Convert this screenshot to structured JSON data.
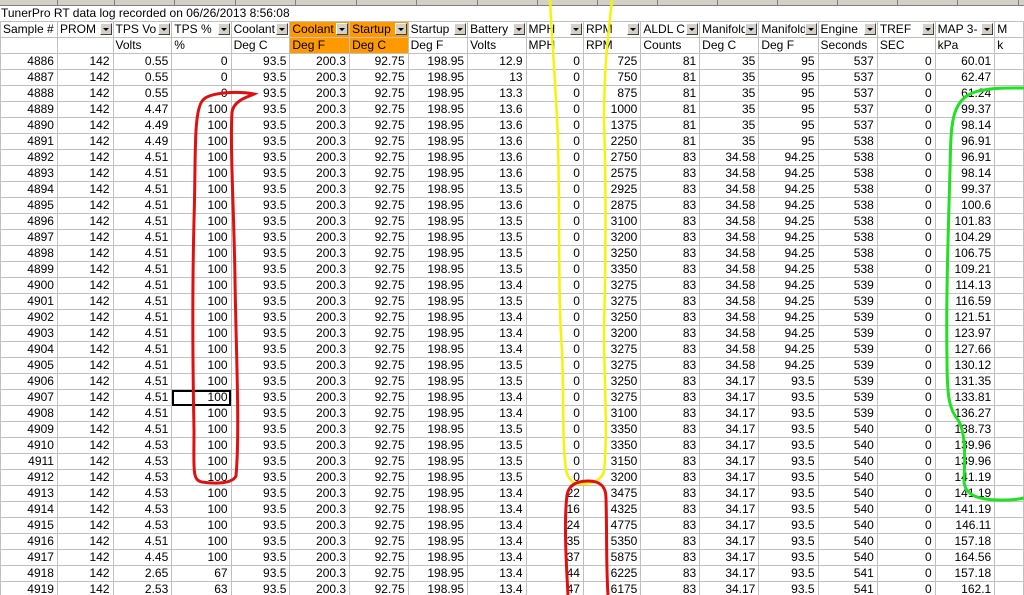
{
  "title": "TunerPro RT data log recorded on 06/26/2013 8:56:08",
  "columns": [
    {
      "header": "Sample #",
      "unit": "",
      "filter": false,
      "highlight": false
    },
    {
      "header": "PROM",
      "unit": "",
      "filter": true,
      "highlight": false
    },
    {
      "header": "TPS Vo",
      "unit": "Volts",
      "filter": true,
      "highlight": false
    },
    {
      "header": "TPS %",
      "unit": "%",
      "filter": true,
      "highlight": false
    },
    {
      "header": "Coolant",
      "unit": "Deg C",
      "filter": true,
      "highlight": false
    },
    {
      "header": "Coolant",
      "unit": "Deg F",
      "filter": true,
      "highlight": true
    },
    {
      "header": "Startup",
      "unit": "Deg C",
      "filter": true,
      "highlight": true
    },
    {
      "header": "Startup",
      "unit": "Deg F",
      "filter": true,
      "highlight": false
    },
    {
      "header": "Battery",
      "unit": "Volts",
      "filter": true,
      "highlight": false
    },
    {
      "header": "MPH",
      "unit": "MPH",
      "filter": true,
      "highlight": false
    },
    {
      "header": "RPM",
      "unit": "RPM",
      "filter": true,
      "highlight": false
    },
    {
      "header": "ALDL C",
      "unit": "Counts",
      "filter": true,
      "highlight": false
    },
    {
      "header": "Manifold",
      "unit": "Deg C",
      "filter": true,
      "highlight": false
    },
    {
      "header": "Manifold",
      "unit": "Deg F",
      "filter": true,
      "highlight": false
    },
    {
      "header": "Engine",
      "unit": "Seconds",
      "filter": true,
      "highlight": false
    },
    {
      "header": "TREF",
      "unit": "SEC",
      "filter": true,
      "highlight": false
    },
    {
      "header": "MAP 3-",
      "unit": "kPa",
      "filter": true,
      "highlight": false
    },
    {
      "header": "M",
      "unit": "k",
      "filter": false,
      "highlight": false
    }
  ],
  "rows": [
    [
      "4886",
      "142",
      "0.55",
      "0",
      "93.5",
      "200.3",
      "92.75",
      "198.95",
      "12.9",
      "0",
      "725",
      "81",
      "35",
      "95",
      "537",
      "0",
      "60.01",
      ""
    ],
    [
      "4887",
      "142",
      "0.55",
      "0",
      "93.5",
      "200.3",
      "92.75",
      "198.95",
      "13",
      "0",
      "750",
      "81",
      "35",
      "95",
      "537",
      "0",
      "62.47",
      ""
    ],
    [
      "4888",
      "142",
      "0.55",
      "0",
      "93.5",
      "200.3",
      "92.75",
      "198.95",
      "13.3",
      "0",
      "875",
      "81",
      "35",
      "95",
      "537",
      "0",
      "61.24",
      ""
    ],
    [
      "4889",
      "142",
      "4.47",
      "100",
      "93.5",
      "200.3",
      "92.75",
      "198.95",
      "13.6",
      "0",
      "1000",
      "81",
      "35",
      "95",
      "537",
      "0",
      "99.37",
      ""
    ],
    [
      "4890",
      "142",
      "4.49",
      "100",
      "93.5",
      "200.3",
      "92.75",
      "198.95",
      "13.6",
      "0",
      "1375",
      "81",
      "35",
      "95",
      "537",
      "0",
      "98.14",
      ""
    ],
    [
      "4891",
      "142",
      "4.49",
      "100",
      "93.5",
      "200.3",
      "92.75",
      "198.95",
      "13.6",
      "0",
      "2250",
      "81",
      "35",
      "95",
      "538",
      "0",
      "96.91",
      ""
    ],
    [
      "4892",
      "142",
      "4.51",
      "100",
      "93.5",
      "200.3",
      "92.75",
      "198.95",
      "13.6",
      "0",
      "2750",
      "83",
      "34.58",
      "94.25",
      "538",
      "0",
      "96.91",
      ""
    ],
    [
      "4893",
      "142",
      "4.51",
      "100",
      "93.5",
      "200.3",
      "92.75",
      "198.95",
      "13.6",
      "0",
      "2575",
      "83",
      "34.58",
      "94.25",
      "538",
      "0",
      "98.14",
      ""
    ],
    [
      "4894",
      "142",
      "4.51",
      "100",
      "93.5",
      "200.3",
      "92.75",
      "198.95",
      "13.5",
      "0",
      "2925",
      "83",
      "34.58",
      "94.25",
      "538",
      "0",
      "99.37",
      ""
    ],
    [
      "4895",
      "142",
      "4.51",
      "100",
      "93.5",
      "200.3",
      "92.75",
      "198.95",
      "13.6",
      "0",
      "2875",
      "83",
      "34.58",
      "94.25",
      "538",
      "0",
      "100.6",
      ""
    ],
    [
      "4896",
      "142",
      "4.51",
      "100",
      "93.5",
      "200.3",
      "92.75",
      "198.95",
      "13.5",
      "0",
      "3100",
      "83",
      "34.58",
      "94.25",
      "538",
      "0",
      "101.83",
      ""
    ],
    [
      "4897",
      "142",
      "4.51",
      "100",
      "93.5",
      "200.3",
      "92.75",
      "198.95",
      "13.5",
      "0",
      "3200",
      "83",
      "34.58",
      "94.25",
      "538",
      "0",
      "104.29",
      ""
    ],
    [
      "4898",
      "142",
      "4.51",
      "100",
      "93.5",
      "200.3",
      "92.75",
      "198.95",
      "13.5",
      "0",
      "3250",
      "83",
      "34.58",
      "94.25",
      "538",
      "0",
      "106.75",
      ""
    ],
    [
      "4899",
      "142",
      "4.51",
      "100",
      "93.5",
      "200.3",
      "92.75",
      "198.95",
      "13.5",
      "0",
      "3350",
      "83",
      "34.58",
      "94.25",
      "538",
      "0",
      "109.21",
      ""
    ],
    [
      "4900",
      "142",
      "4.51",
      "100",
      "93.5",
      "200.3",
      "92.75",
      "198.95",
      "13.4",
      "0",
      "3275",
      "83",
      "34.58",
      "94.25",
      "539",
      "0",
      "114.13",
      ""
    ],
    [
      "4901",
      "142",
      "4.51",
      "100",
      "93.5",
      "200.3",
      "92.75",
      "198.95",
      "13.5",
      "0",
      "3275",
      "83",
      "34.58",
      "94.25",
      "539",
      "0",
      "116.59",
      ""
    ],
    [
      "4902",
      "142",
      "4.51",
      "100",
      "93.5",
      "200.3",
      "92.75",
      "198.95",
      "13.4",
      "0",
      "3250",
      "83",
      "34.58",
      "94.25",
      "539",
      "0",
      "121.51",
      ""
    ],
    [
      "4903",
      "142",
      "4.51",
      "100",
      "93.5",
      "200.3",
      "92.75",
      "198.95",
      "13.4",
      "0",
      "3200",
      "83",
      "34.58",
      "94.25",
      "539",
      "0",
      "123.97",
      ""
    ],
    [
      "4904",
      "142",
      "4.51",
      "100",
      "93.5",
      "200.3",
      "92.75",
      "198.95",
      "13.4",
      "0",
      "3275",
      "83",
      "34.58",
      "94.25",
      "539",
      "0",
      "127.66",
      ""
    ],
    [
      "4905",
      "142",
      "4.51",
      "100",
      "93.5",
      "200.3",
      "92.75",
      "198.95",
      "13.5",
      "0",
      "3275",
      "83",
      "34.58",
      "94.25",
      "539",
      "0",
      "130.12",
      ""
    ],
    [
      "4906",
      "142",
      "4.51",
      "100",
      "93.5",
      "200.3",
      "92.75",
      "198.95",
      "13.5",
      "0",
      "3250",
      "83",
      "34.17",
      "93.5",
      "539",
      "0",
      "131.35",
      ""
    ],
    [
      "4907",
      "142",
      "4.51",
      "100",
      "93.5",
      "200.3",
      "92.75",
      "198.95",
      "13.4",
      "0",
      "3275",
      "83",
      "34.17",
      "93.5",
      "539",
      "0",
      "133.81",
      ""
    ],
    [
      "4908",
      "142",
      "4.51",
      "100",
      "93.5",
      "200.3",
      "92.75",
      "198.95",
      "13.4",
      "0",
      "3100",
      "83",
      "34.17",
      "93.5",
      "539",
      "0",
      "136.27",
      ""
    ],
    [
      "4909",
      "142",
      "4.51",
      "100",
      "93.5",
      "200.3",
      "92.75",
      "198.95",
      "13.5",
      "0",
      "3350",
      "83",
      "34.17",
      "93.5",
      "540",
      "0",
      "138.73",
      ""
    ],
    [
      "4910",
      "142",
      "4.53",
      "100",
      "93.5",
      "200.3",
      "92.75",
      "198.95",
      "13.5",
      "0",
      "3350",
      "83",
      "34.17",
      "93.5",
      "540",
      "0",
      "139.96",
      ""
    ],
    [
      "4911",
      "142",
      "4.53",
      "100",
      "93.5",
      "200.3",
      "92.75",
      "198.95",
      "13.5",
      "0",
      "3150",
      "83",
      "34.17",
      "93.5",
      "540",
      "0",
      "139.96",
      ""
    ],
    [
      "4912",
      "142",
      "4.53",
      "100",
      "93.5",
      "200.3",
      "92.75",
      "198.95",
      "13.5",
      "0",
      "3200",
      "83",
      "34.17",
      "93.5",
      "540",
      "0",
      "141.19",
      ""
    ],
    [
      "4913",
      "142",
      "4.53",
      "100",
      "93.5",
      "200.3",
      "92.75",
      "198.95",
      "13.4",
      "22",
      "3475",
      "83",
      "34.17",
      "93.5",
      "540",
      "0",
      "141.19",
      ""
    ],
    [
      "4914",
      "142",
      "4.53",
      "100",
      "93.5",
      "200.3",
      "92.75",
      "198.95",
      "13.4",
      "16",
      "4325",
      "83",
      "34.17",
      "93.5",
      "540",
      "0",
      "141.19",
      ""
    ],
    [
      "4915",
      "142",
      "4.53",
      "100",
      "93.5",
      "200.3",
      "92.75",
      "198.95",
      "13.4",
      "24",
      "4775",
      "83",
      "34.17",
      "93.5",
      "540",
      "0",
      "146.11",
      ""
    ],
    [
      "4916",
      "142",
      "4.51",
      "100",
      "93.5",
      "200.3",
      "92.75",
      "198.95",
      "13.4",
      "35",
      "5350",
      "83",
      "34.17",
      "93.5",
      "540",
      "0",
      "157.18",
      ""
    ],
    [
      "4917",
      "142",
      "4.45",
      "100",
      "93.5",
      "200.3",
      "92.75",
      "198.95",
      "13.4",
      "37",
      "5875",
      "83",
      "34.17",
      "93.5",
      "540",
      "0",
      "164.56",
      ""
    ],
    [
      "4918",
      "142",
      "2.65",
      "67",
      "93.5",
      "200.3",
      "92.75",
      "198.95",
      "13.4",
      "44",
      "6225",
      "83",
      "34.17",
      "93.5",
      "541",
      "0",
      "157.18",
      ""
    ],
    [
      "4919",
      "142",
      "2.53",
      "63",
      "93.5",
      "200.3",
      "92.75",
      "198.95",
      "13.4",
      "47",
      "6175",
      "83",
      "34.17",
      "93.5",
      "541",
      "0",
      "162.1",
      ""
    ]
  ],
  "active_cell": {
    "row": 21,
    "col": 3
  },
  "annotation_colors": {
    "red": "#e01010",
    "yellow": "#f4f40a",
    "green": "#22e022"
  }
}
